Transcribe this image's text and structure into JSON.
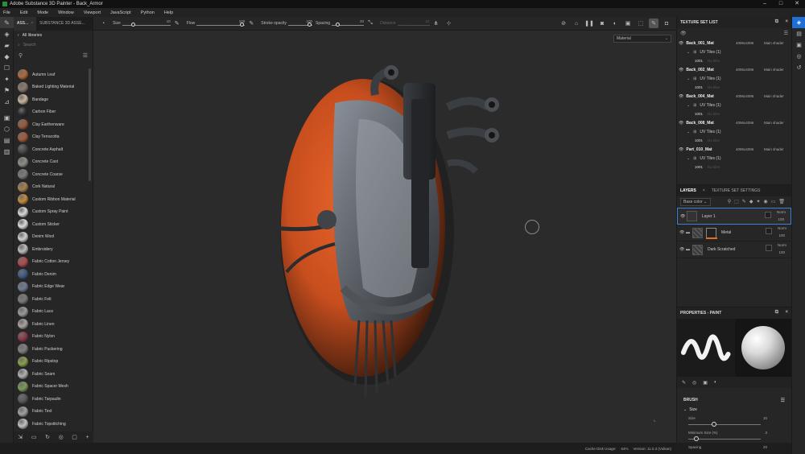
{
  "window": {
    "title": "Adobe Substance 3D Painter - Back_Armor",
    "controls": [
      "–",
      "□",
      "✕"
    ]
  },
  "menu": [
    "File",
    "Edit",
    "Mode",
    "Window",
    "Viewport",
    "JavaScript",
    "Python",
    "Help"
  ],
  "shelf": {
    "tabs": [
      "ASS...",
      "SUBSTANCE 3D ASSE..."
    ],
    "breadcrumb": "All libraries",
    "search_placeholder": "Search",
    "materials": [
      {
        "name": "Autumn Leaf",
        "color": "#b06a3a"
      },
      {
        "name": "Baked Lighting Material",
        "color": "#8c7b6e"
      },
      {
        "name": "Bandage",
        "color": "#c9b59a"
      },
      {
        "name": "Carbon Fiber",
        "color": "#2b2b2b"
      },
      {
        "name": "Clay Earthenware",
        "color": "#9a5a3a"
      },
      {
        "name": "Clay Terracotta",
        "color": "#a4593a"
      },
      {
        "name": "Concrete Asphalt",
        "color": "#4a4a4a"
      },
      {
        "name": "Concrete Cast",
        "color": "#8d8d88"
      },
      {
        "name": "Concrete Coarse",
        "color": "#7b7b78"
      },
      {
        "name": "Cork Natural",
        "color": "#a88050"
      },
      {
        "name": "Custom Ribbon Material",
        "color": "#c48a3a"
      },
      {
        "name": "Custom Spray Paint",
        "color": "#d8d8d8"
      },
      {
        "name": "Custom Sticker",
        "color": "#dcdcdc"
      },
      {
        "name": "Denim Wool",
        "color": "#cfcfcf"
      },
      {
        "name": "Embroidery",
        "color": "#bcbcbc"
      },
      {
        "name": "Fabric Cotton Jersey",
        "color": "#b04a4a"
      },
      {
        "name": "Fabric Denim",
        "color": "#3f5a86"
      },
      {
        "name": "Fabric Edge Wear",
        "color": "#6f7a92"
      },
      {
        "name": "Fabric Felt",
        "color": "#7a7a7a"
      },
      {
        "name": "Fabric Lace",
        "color": "#9a9a9a"
      },
      {
        "name": "Fabric Linen",
        "color": "#a9a49a"
      },
      {
        "name": "Fabric Nylon",
        "color": "#8b3a4a"
      },
      {
        "name": "Fabric Puckering",
        "color": "#7f7f7f"
      },
      {
        "name": "Fabric Ripstop",
        "color": "#8aa04a"
      },
      {
        "name": "Fabric Seam",
        "color": "#b0b0b0"
      },
      {
        "name": "Fabric Spacer Mesh",
        "color": "#7a9a5a"
      },
      {
        "name": "Fabric Tarpaulin",
        "color": "#5a5a5a"
      },
      {
        "name": "Fabric Text",
        "color": "#a0a0a0"
      },
      {
        "name": "Fabric Topstitching",
        "color": "#c0c0c0"
      }
    ]
  },
  "toolbar": {
    "size_label": "Size",
    "size_value": "10",
    "size_level": 0.2,
    "flow_label": "Flow",
    "flow_value": "100",
    "flow_level": 1.0,
    "opacity_label": "Stroke opacity",
    "opacity_value": "100",
    "opacity_level": 1.0,
    "spacing_label": "Spacing",
    "spacing_value": "20",
    "spacing_level": 0.15,
    "distance_label": "Distance",
    "distance_value": "10"
  },
  "viewport": {
    "material_select": "Material"
  },
  "status": {
    "cache": "Cache Disk Usage:",
    "cache_value": "64%",
    "version": "Version: 11.0.3 (Vulkan)"
  },
  "texture_set_list": {
    "title": "TEXTURE SET LIST",
    "sets": [
      {
        "name": "Back_001_Mat",
        "res": "4096x4096",
        "shader": "Main shader",
        "uv": "UV Tiles (1)",
        "tile": "1001",
        "tile_hint": "No tiles"
      },
      {
        "name": "Back_002_Mat",
        "res": "4096x4096",
        "shader": "Main shader",
        "uv": "UV Tiles (1)",
        "tile": "1001",
        "tile_hint": "No tiles"
      },
      {
        "name": "Back_004_Mat",
        "res": "4096x4096",
        "shader": "Main shader",
        "uv": "UV Tiles (1)",
        "tile": "1001",
        "tile_hint": "No tiles"
      },
      {
        "name": "Back_008_Mat",
        "res": "4096x4096",
        "shader": "Main shader",
        "uv": "UV Tiles (1)",
        "tile": "1001",
        "tile_hint": "No tiles"
      },
      {
        "name": "Part_010_Mat",
        "res": "4096x4096",
        "shader": "Main shader",
        "uv": "UV Tiles (1)",
        "tile": "1001",
        "tile_hint": "No tiles"
      }
    ]
  },
  "layers": {
    "tab_layers": "LAYERS",
    "tab_settings": "TEXTURE SET SETTINGS",
    "channel": "Base color",
    "items": [
      {
        "name": "Layer 1",
        "blend": "Norm",
        "opacity": "100"
      },
      {
        "name": "Metal",
        "blend": "Norm",
        "opacity": "100"
      },
      {
        "name": "Dark Scratched",
        "blend": "Norm",
        "opacity": "100"
      }
    ]
  },
  "properties": {
    "title": "PROPERTIES - PAINT",
    "brush": "BRUSH",
    "size_section": "Size",
    "size_label": "Size",
    "size_value": "10",
    "size_level": 0.35,
    "minsize_label": "Minimum Size (%)",
    "minsize_value": "3",
    "minsize_level": 0.08,
    "spacing_label": "Spacing",
    "spacing_value": "20"
  }
}
